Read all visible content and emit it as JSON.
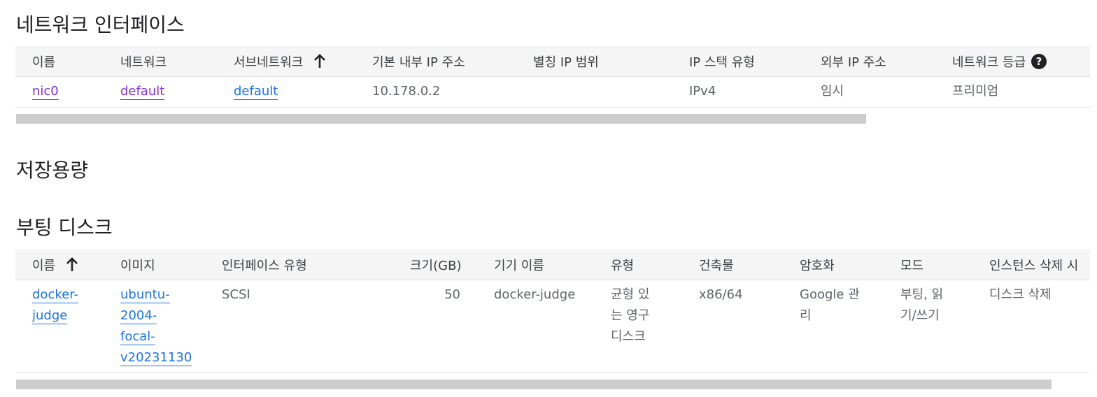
{
  "network": {
    "title": "네트워크 인터페이스",
    "columns": [
      "이름",
      "네트워크",
      "서브네트워크",
      "기본 내부 IP 주소",
      "별칭 IP 범위",
      "IP 스택 유형",
      "외부 IP 주소",
      "네트워크 등급"
    ],
    "row": {
      "name": "nic0",
      "network": "default",
      "subnetwork": "default",
      "internal_ip": "10.178.0.2",
      "alias_ip": "",
      "stack_type": "IPv4",
      "external_ip": "임시",
      "tier": "프리미엄"
    }
  },
  "storage": {
    "title": "저장용량"
  },
  "boot_disk": {
    "title": "부팅 디스크",
    "columns": [
      "이름",
      "이미지",
      "인터페이스 유형",
      "크기(GB)",
      "기기 이름",
      "유형",
      "건축물",
      "암호화",
      "모드",
      "인스턴스 삭제 시"
    ],
    "row": {
      "name_lines": [
        "docker-",
        "judge"
      ],
      "image_lines": [
        "ubuntu-",
        "2004-",
        "focal-",
        "v20231130"
      ],
      "interface": "SCSI",
      "size": "50",
      "device_name": "docker-judge",
      "type_lines": [
        "균형 있",
        "는 영구",
        "디스크"
      ],
      "arch": "x86/64",
      "encryption_lines": [
        "Google 관",
        "리"
      ],
      "mode_lines": [
        "부팅, 읽",
        "기/쓰기"
      ],
      "on_delete": "디스크 삭제"
    }
  },
  "colors": {
    "link": "#1a73e8",
    "visited_link": "#8430ce",
    "header_bg": "#f5f5f5"
  }
}
